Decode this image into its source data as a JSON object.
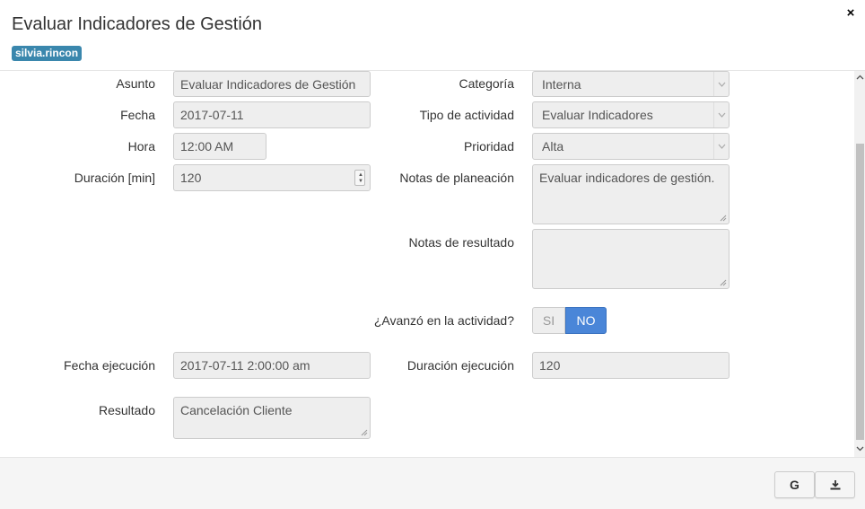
{
  "header": {
    "title": "Evaluar Indicadores de Gestión",
    "user_badge": "silvia.rincon",
    "close_icon": "×"
  },
  "form": {
    "asunto": {
      "label": "Asunto",
      "value": "Evaluar Indicadores de Gestión"
    },
    "fecha": {
      "label": "Fecha",
      "value": "2017-07-11"
    },
    "hora": {
      "label": "Hora",
      "value": "12:00 AM"
    },
    "duracion": {
      "label": "Duración [min]",
      "value": "120"
    },
    "categoria": {
      "label": "Categoría",
      "value": "Interna"
    },
    "tipo_actividad": {
      "label": "Tipo de actividad",
      "value": "Evaluar Indicadores"
    },
    "prioridad": {
      "label": "Prioridad",
      "value": "Alta"
    },
    "notas_planeacion": {
      "label": "Notas de planeación",
      "value": "Evaluar indicadores de gestión."
    },
    "notas_resultado": {
      "label": "Notas de resultado",
      "value": ""
    },
    "avanzo": {
      "label": "¿Avanzó en la actividad?",
      "options": [
        "SI",
        "NO"
      ],
      "selected": "NO"
    },
    "fecha_ejecucion": {
      "label": "Fecha ejecución",
      "value": "2017-07-11 2:00:00 am"
    },
    "duracion_ejecucion": {
      "label": "Duración ejecución",
      "value": "120"
    },
    "resultado": {
      "label": "Resultado",
      "value": "Cancelación Cliente"
    }
  },
  "footer": {
    "google_button": "G",
    "download_icon": "download-icon"
  },
  "colors": {
    "badge": "#3a87ad",
    "toggle_active": "#4a86d8",
    "field_bg": "#eeeeee"
  }
}
